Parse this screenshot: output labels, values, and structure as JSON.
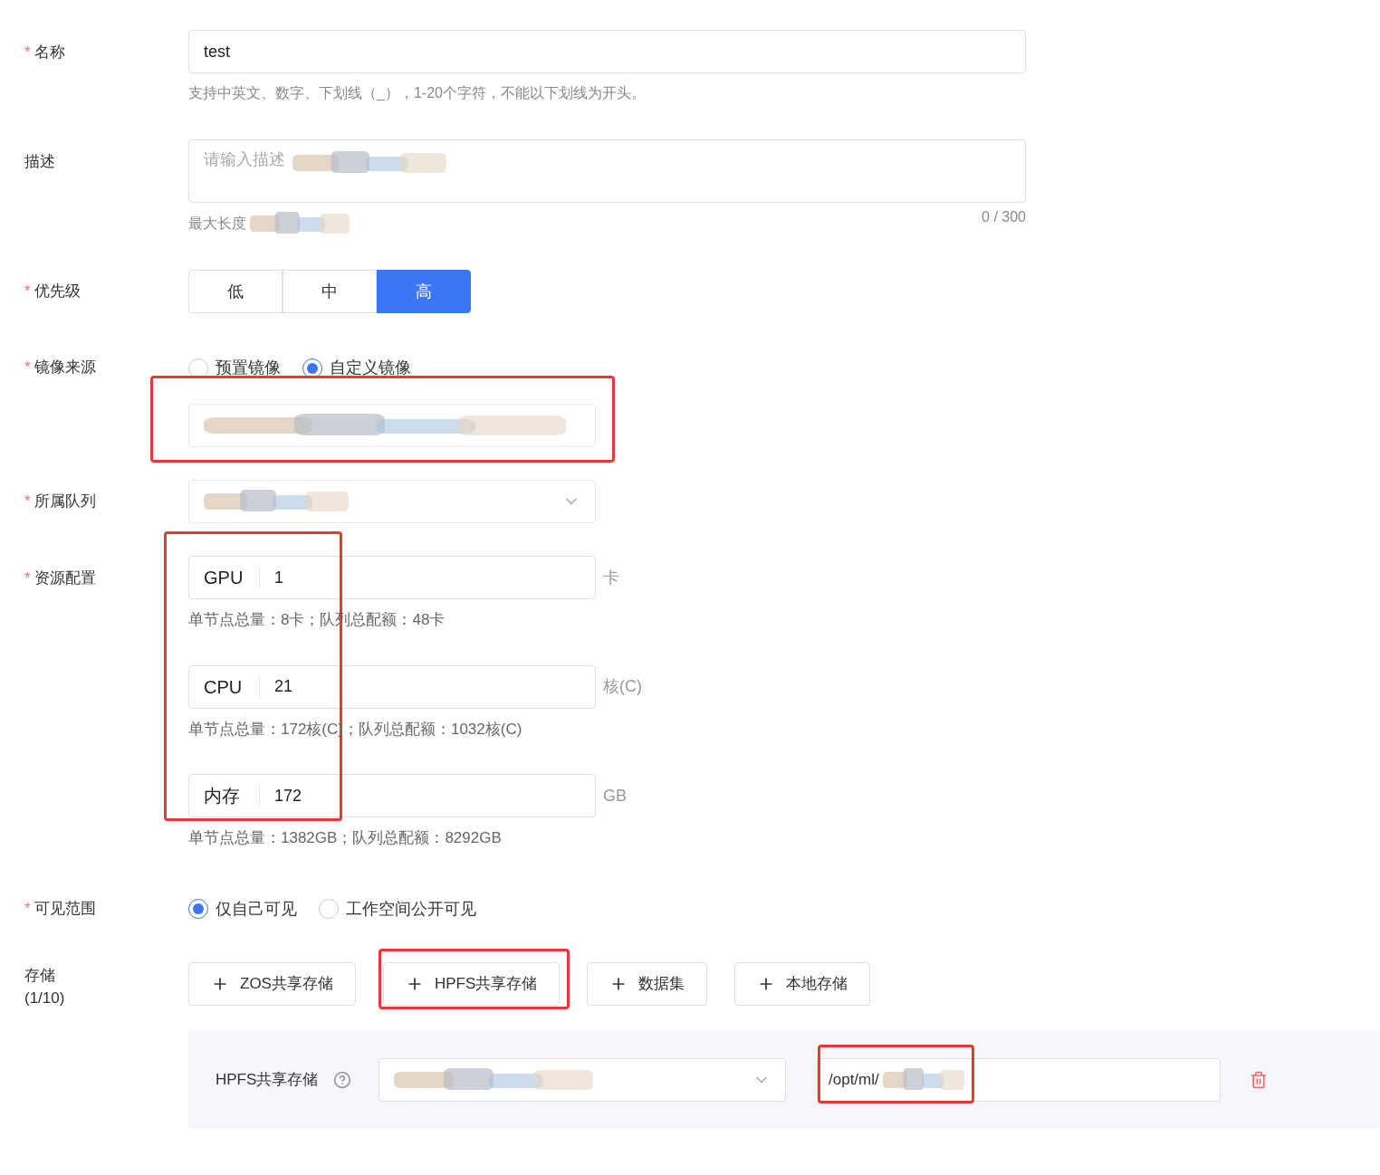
{
  "name_field": {
    "label": "名称",
    "required_mark": "*",
    "value": "test",
    "hint": "支持中英文、数字、下划线（_），1-20个字符，不能以下划线为开头。"
  },
  "description_field": {
    "label": "描述",
    "placeholder": "请输入描述",
    "counter": "0 / 300",
    "hint": "最大长度"
  },
  "priority": {
    "label": "优先级",
    "required_mark": "*",
    "options": [
      {
        "label": "低",
        "selected": false
      },
      {
        "label": "中",
        "selected": false
      },
      {
        "label": "高",
        "selected": true
      }
    ]
  },
  "image_source": {
    "label": "镜像来源",
    "required_mark": "*",
    "options": [
      {
        "label": "预置镜像",
        "selected": false
      },
      {
        "label": "自定义镜像",
        "selected": true
      }
    ]
  },
  "queue": {
    "label": "所属队列",
    "required_mark": "*"
  },
  "resources": {
    "label": "资源配置",
    "required_mark": "*",
    "items": [
      {
        "name": "GPU",
        "value": "1",
        "unit": "卡",
        "hint": "单节点总量：8卡；队列总配额：48卡"
      },
      {
        "name": "CPU",
        "value": "21",
        "unit": "核(C)",
        "hint": "单节点总量：172核(C)；队列总配额：1032核(C)"
      },
      {
        "name": "内存",
        "value": "172",
        "unit": "GB",
        "hint": "单节点总量：1382GB；队列总配额：8292GB"
      }
    ]
  },
  "visibility": {
    "label": "可见范围",
    "required_mark": "*",
    "options": [
      {
        "label": "仅自己可见",
        "selected": true
      },
      {
        "label": "工作空间公开可见",
        "selected": false
      }
    ]
  },
  "storage": {
    "label": "存储",
    "count": "(1/10)",
    "buttons": [
      "ZOS共享存储",
      "HPFS共享存储",
      "数据集",
      "本地存储"
    ],
    "mounts": [
      {
        "type": "HPFS共享存储",
        "path": "/opt/ml/"
      }
    ]
  }
}
